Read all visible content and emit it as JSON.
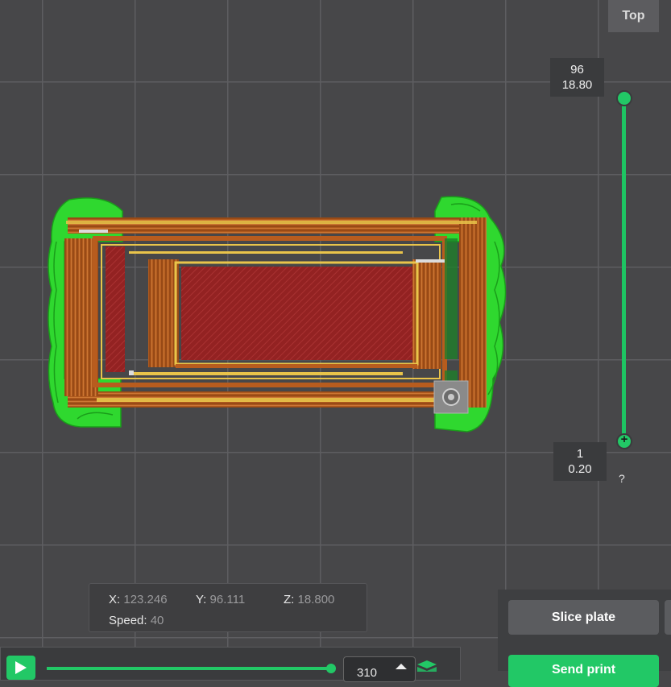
{
  "view": {
    "label": "Top"
  },
  "layer_slider": {
    "top": {
      "layer": "96",
      "height": "18.80"
    },
    "bottom": {
      "layer": "1",
      "height": "0.20"
    },
    "help": "?"
  },
  "info": {
    "x_label": "X:",
    "x_value": "123.246",
    "y_label": "Y:",
    "y_value": "96.111",
    "z_label": "Z:",
    "z_value": "18.800",
    "speed_label": "Speed:",
    "speed_value": "40"
  },
  "moves": {
    "value": "310"
  },
  "actions": {
    "slice": "Slice plate",
    "send": "Send print"
  },
  "colors": {
    "accent": "#22c866",
    "wall": "#b85c1e",
    "infill": "#9a2323",
    "outline": "#e9c44a",
    "skirt": "#2fd82f"
  },
  "icons": {
    "play": "play-icon",
    "layers": "layers-icon",
    "spin_up": "arrow-up-icon"
  }
}
